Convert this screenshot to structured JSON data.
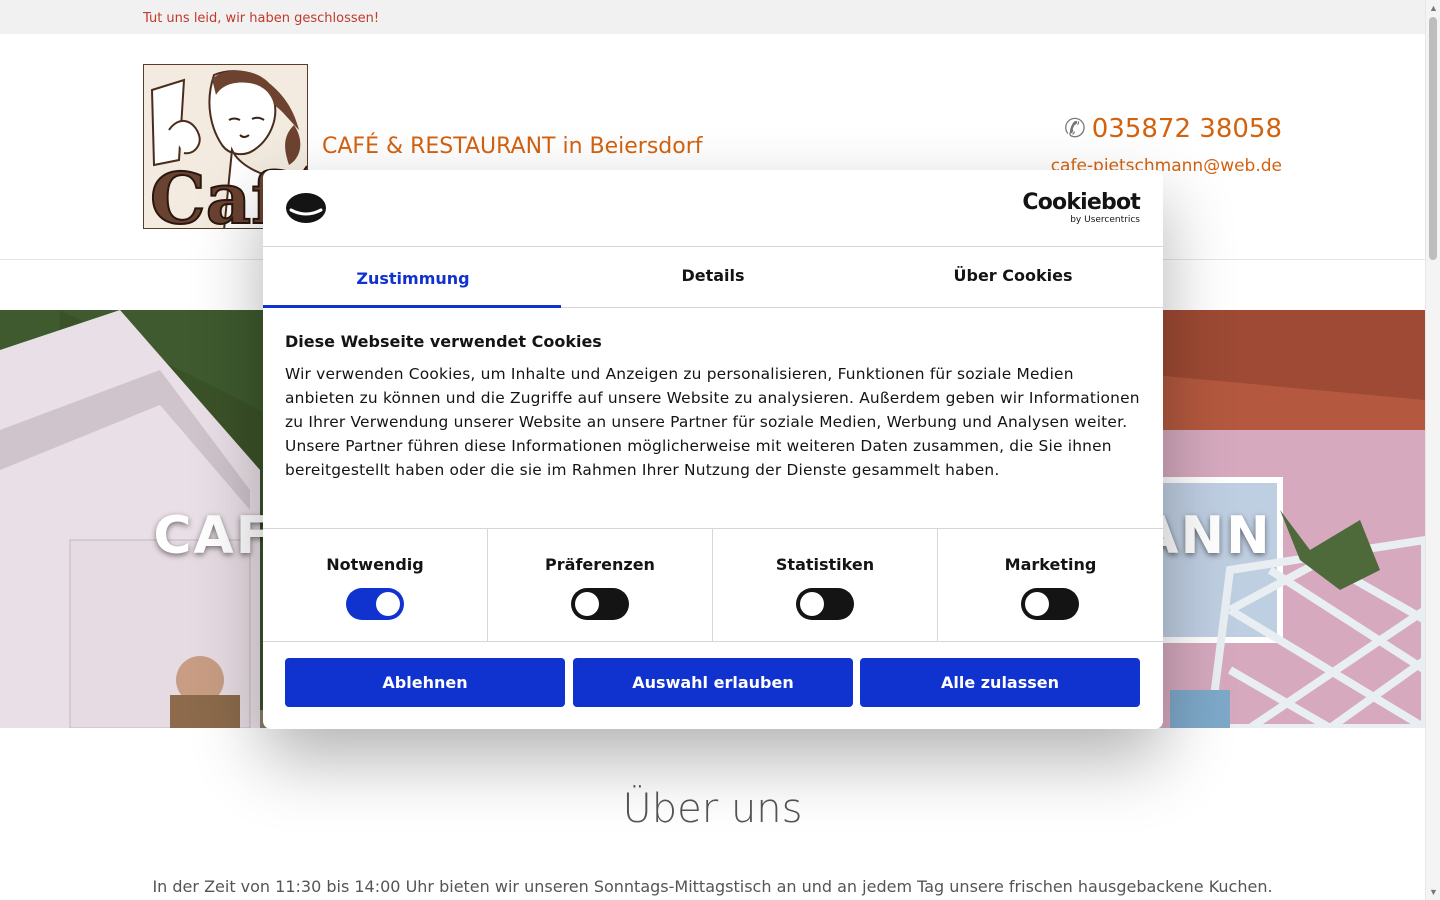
{
  "notice": "Tut uns leid, wir haben geschlossen!",
  "header": {
    "logo_text": "Café",
    "tagline": "CAFÉ & RESTAURANT in Beiersdorf",
    "phone": "035872 38058",
    "email": "cafe-pietschmann@web.de"
  },
  "hero": {
    "title": "CAFÉ & RESTAURANT PIETSCHMANN"
  },
  "about": {
    "title": "Über uns",
    "text": "In der Zeit von 11:30 bis 14:00 Uhr bieten wir unseren Sonntags-Mittagstisch an und an jedem Tag unsere frischen hausgebackene Kuchen."
  },
  "cookie_dialog": {
    "brand": "Cookiebot",
    "brand_sub": "by Usercentrics",
    "tabs": [
      {
        "label": "Zustimmung",
        "active": true
      },
      {
        "label": "Details",
        "active": false
      },
      {
        "label": "Über Cookies",
        "active": false
      }
    ],
    "title": "Diese Webseite verwendet Cookies",
    "text": "Wir verwenden Cookies, um Inhalte und Anzeigen zu personalisieren, Funktionen für soziale Medien anbieten zu können und die Zugriffe auf unsere Website zu analysieren. Außerdem geben wir Informationen zu Ihrer Verwendung unserer Website an unsere Partner für soziale Medien, Werbung und Analysen weiter. Unsere Partner führen diese Informationen möglicherweise mit weiteren Daten zusammen, die Sie ihnen bereitgestellt haben oder die sie im Rahmen Ihrer Nutzung der Dienste gesammelt haben.",
    "toggles": [
      {
        "label": "Notwendig",
        "checked": true
      },
      {
        "label": "Präferenzen",
        "checked": false
      },
      {
        "label": "Statistiken",
        "checked": false
      },
      {
        "label": "Marketing",
        "checked": false
      }
    ],
    "buttons": {
      "decline": "Ablehnen",
      "allow_selection": "Auswahl erlauben",
      "allow_all": "Alle zulassen"
    }
  },
  "colors": {
    "accent_orange": "#d3620f",
    "cookiebot_blue": "#1032cf",
    "notice_red": "#c0392b"
  }
}
